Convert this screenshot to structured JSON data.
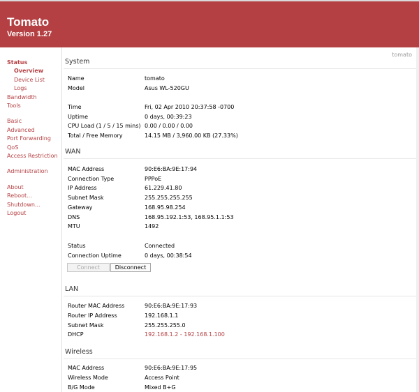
{
  "app": {
    "title": "Tomato",
    "version": "Version 1.27",
    "hostname": "tomato"
  },
  "sidebar": {
    "status": "Status",
    "overview": "Overview",
    "device_list": "Device List",
    "logs": "Logs",
    "bandwidth": "Bandwidth",
    "tools": "Tools",
    "basic": "Basic",
    "advanced": "Advanced",
    "port_forwarding": "Port Forwarding",
    "qos": "QoS",
    "access_restriction": "Access Restriction",
    "administration": "Administration",
    "about": "About",
    "reboot": "Reboot...",
    "shutdown": "Shutdown...",
    "logout": "Logout"
  },
  "system": {
    "title": "System",
    "rows": [
      {
        "label": "Name",
        "value": "tomato"
      },
      {
        "label": "Model",
        "value": "Asus WL-520GU"
      },
      {
        "label": "Time",
        "value": "Fri, 02 Apr 2010 20:37:58 -0700"
      },
      {
        "label": "Uptime",
        "value": "0 days, 00:39:23"
      },
      {
        "label": "CPU Load (1 / 5 / 15 mins)",
        "value": "0.00 / 0.00 / 0.00"
      },
      {
        "label": "Total / Free Memory",
        "value": "14.15 MB / 3,960.00 KB (27.33%)"
      }
    ]
  },
  "wan": {
    "title": "WAN",
    "rows": [
      {
        "label": "MAC Address",
        "value": "90:E6:BA:9E:17:94"
      },
      {
        "label": "Connection Type",
        "value": "PPPoE"
      },
      {
        "label": "IP Address",
        "value": "61.229.41.80"
      },
      {
        "label": "Subnet Mask",
        "value": "255.255.255.255"
      },
      {
        "label": "Gateway",
        "value": "168.95.98.254"
      },
      {
        "label": "DNS",
        "value": "168.95.192.1:53, 168.95.1.1:53"
      },
      {
        "label": "MTU",
        "value": "1492"
      },
      {
        "label": "Status",
        "value": "Connected"
      },
      {
        "label": "Connection Uptime",
        "value": "0 days, 00:38:54"
      }
    ],
    "connect_label": "Connect",
    "disconnect_label": "Disconnect"
  },
  "lan": {
    "title": "LAN",
    "rows": [
      {
        "label": "Router MAC Address",
        "value": "90:E6:BA:9E:17:93"
      },
      {
        "label": "Router IP Address",
        "value": "192.168.1.1"
      },
      {
        "label": "Subnet Mask",
        "value": "255.255.255.0"
      },
      {
        "label": "DHCP",
        "value": "192.168.1.2 - 192.168.1.100"
      }
    ]
  },
  "wireless": {
    "title": "Wireless",
    "rows": [
      {
        "label": "MAC Address",
        "value": "90:E6:BA:9E:17:95"
      },
      {
        "label": "Wireless Mode",
        "value": "Access Point"
      },
      {
        "label": "B/G Mode",
        "value": "Mixed B+G"
      }
    ]
  },
  "colors": {
    "header": "#b54043",
    "link": "#b54043"
  }
}
